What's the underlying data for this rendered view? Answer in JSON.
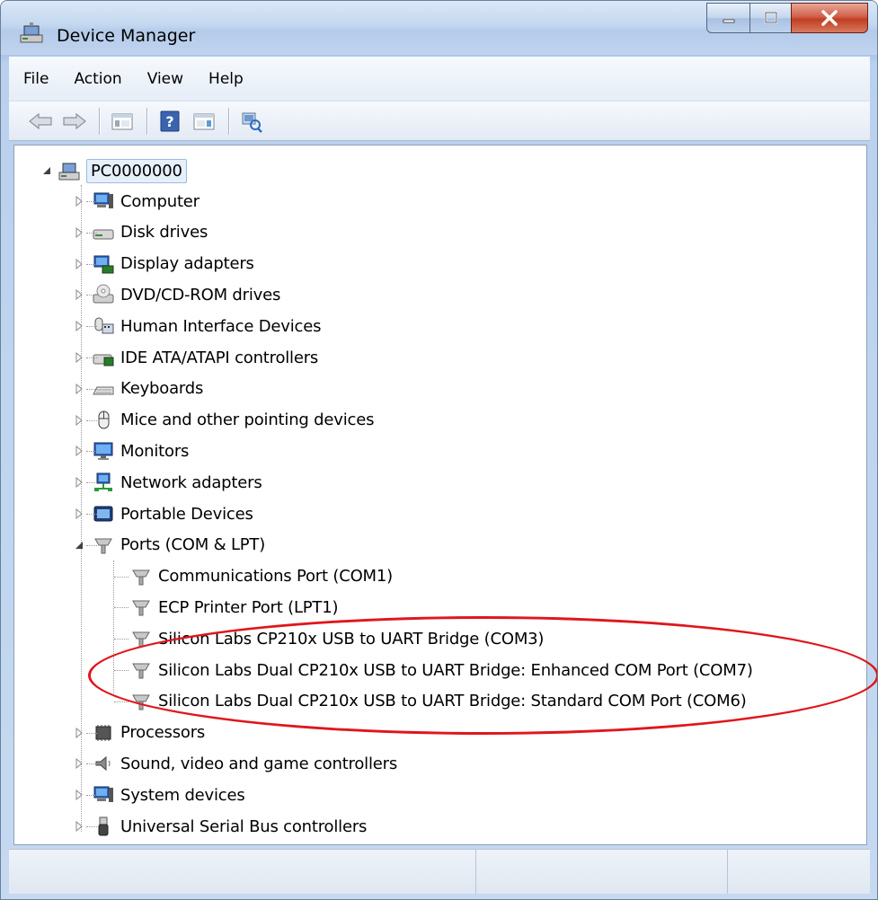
{
  "window": {
    "title": "Device Manager",
    "icon": "device-manager-icon"
  },
  "menu": {
    "items": [
      {
        "label": "File"
      },
      {
        "label": "Action"
      },
      {
        "label": "View"
      },
      {
        "label": "Help"
      }
    ]
  },
  "toolbar": {
    "buttons": [
      {
        "name": "back-arrow-icon"
      },
      {
        "name": "forward-arrow-icon"
      },
      {
        "name": "properties-view-icon"
      },
      {
        "name": "help-icon"
      },
      {
        "name": "details-view-icon"
      },
      {
        "name": "scan-hardware-icon"
      }
    ]
  },
  "tree": {
    "root": {
      "label": "PC0000000",
      "icon": "computer-network-icon",
      "expanded": true
    },
    "categories": [
      {
        "label": "Computer",
        "icon": "computer-icon"
      },
      {
        "label": "Disk drives",
        "icon": "disk-drive-icon"
      },
      {
        "label": "Display adapters",
        "icon": "display-adapter-icon"
      },
      {
        "label": "DVD/CD-ROM drives",
        "icon": "dvd-drive-icon"
      },
      {
        "label": "Human Interface Devices",
        "icon": "hid-icon"
      },
      {
        "label": "IDE ATA/ATAPI controllers",
        "icon": "ide-controller-icon"
      },
      {
        "label": "Keyboards",
        "icon": "keyboard-icon"
      },
      {
        "label": "Mice and other pointing devices",
        "icon": "mouse-icon"
      },
      {
        "label": "Monitors",
        "icon": "monitor-icon"
      },
      {
        "label": "Network adapters",
        "icon": "network-adapter-icon"
      },
      {
        "label": "Portable Devices",
        "icon": "portable-device-icon"
      },
      {
        "label": "Ports (COM & LPT)",
        "icon": "port-icon",
        "expanded": true
      },
      {
        "label": "Processors",
        "icon": "processor-icon"
      },
      {
        "label": "Sound, video and game controllers",
        "icon": "sound-icon"
      },
      {
        "label": "System devices",
        "icon": "system-device-icon"
      },
      {
        "label": "Universal Serial Bus controllers",
        "icon": "usb-icon"
      }
    ],
    "ports": [
      {
        "label": "Communications Port (COM1)"
      },
      {
        "label": "ECP Printer Port (LPT1)"
      },
      {
        "label": "Silicon Labs CP210x USB to UART Bridge (COM3)"
      },
      {
        "label": "Silicon Labs Dual CP210x USB to UART Bridge: Enhanced COM Port (COM7)"
      },
      {
        "label": "Silicon Labs Dual CP210x USB to UART Bridge: Standard COM Port (COM6)"
      }
    ]
  },
  "colors": {
    "highlight_annotation": "#e0161c",
    "selection_border": "#9bbbe6"
  }
}
